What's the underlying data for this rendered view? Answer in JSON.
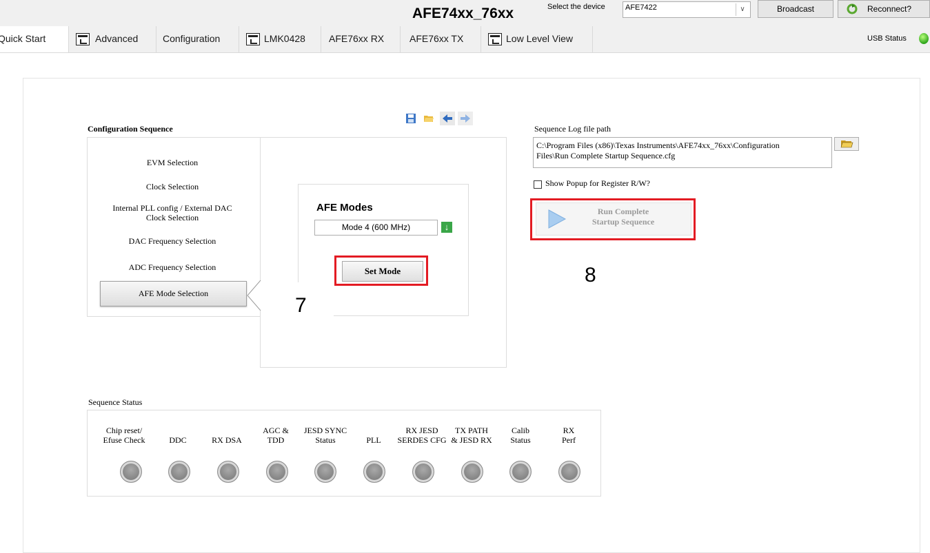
{
  "header": {
    "title": "AFE74xx_76xx",
    "select_label": "Select the device",
    "device_value": "AFE7422",
    "broadcast_label": "Broadcast",
    "reconnect_label": "Reconnect?"
  },
  "tabs": [
    {
      "label": "Quick Start",
      "active": true,
      "icon": ""
    },
    {
      "label": "Advanced",
      "active": false,
      "icon": "panel-icon"
    },
    {
      "label": "Configuration",
      "active": false,
      "icon": ""
    },
    {
      "label": "LMK0428",
      "active": false,
      "icon": "panel-icon"
    },
    {
      "label": "AFE76xx RX",
      "active": false,
      "icon": ""
    },
    {
      "label": "AFE76xx TX",
      "active": false,
      "icon": ""
    },
    {
      "label": "Low Level View",
      "active": false,
      "icon": "list-panel-icon"
    }
  ],
  "usb": {
    "label": "USB Status",
    "color": "#2fa51d"
  },
  "config": {
    "title": "Configuration Sequence",
    "steps": [
      "EVM Selection",
      "Clock Selection",
      "Internal PLL config / External DAC Clock Selection",
      "DAC Frequency Selection",
      "ADC Frequency Selection"
    ],
    "active_step": "AFE Mode Selection"
  },
  "afe": {
    "title": "AFE Modes",
    "mode_value": "Mode 4 (600 MHz)",
    "set_mode_label": "Set Mode"
  },
  "callouts": {
    "seven": "7",
    "eight": "8",
    "highlight_color": "#e31b23"
  },
  "log": {
    "label": "Sequence Log file path",
    "path_line1": "C:\\Program Files (x86)\\Texas Instruments\\AFE74xx_76xx\\Configuration",
    "path_line2": "Files\\Run Complete Startup Sequence.cfg",
    "popup_label": "Show Popup for Register R/W?",
    "popup_checked": false
  },
  "run": {
    "line1": "Run Complete",
    "line2": "Startup Sequence"
  },
  "status": {
    "title": "Sequence Status",
    "items": [
      {
        "l1": "Chip reset/",
        "l2": "Efuse Check"
      },
      {
        "l1": "DDC",
        "l2": ""
      },
      {
        "l1": "RX DSA",
        "l2": ""
      },
      {
        "l1": "AGC &",
        "l2": "TDD"
      },
      {
        "l1": "JESD SYNC",
        "l2": "Status"
      },
      {
        "l1": "PLL",
        "l2": ""
      },
      {
        "l1": "RX JESD",
        "l2": "SERDES CFG"
      },
      {
        "l1": "TX PATH",
        "l2": "& JESD RX"
      },
      {
        "l1": "Calib",
        "l2": "Status"
      },
      {
        "l1": "RX",
        "l2": "Perf"
      }
    ]
  }
}
